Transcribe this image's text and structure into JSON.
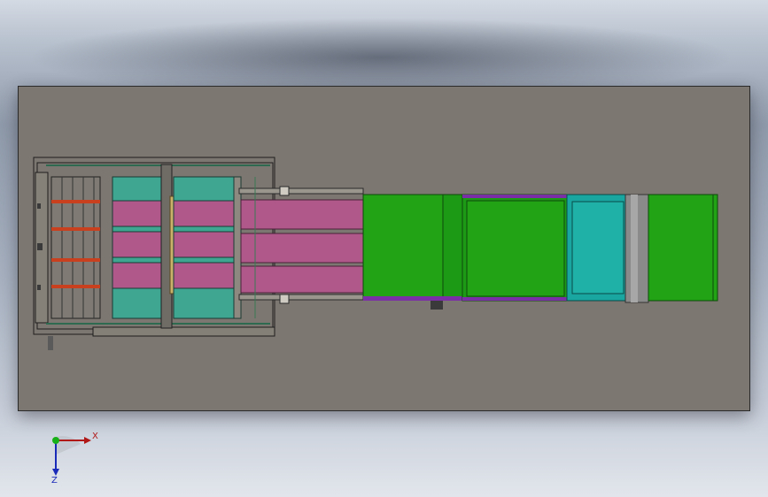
{
  "triad": {
    "x_label": "X",
    "z_label": "Z"
  },
  "colors": {
    "background_top": "#d4dae3",
    "plate": "#7c7770",
    "teal_panel": "#3fa692",
    "pink_panel": "#b0588a",
    "green_conveyor": "#22a316",
    "green_conveyor_dark": "#1d9a15",
    "cyan_section": "#1aa6a0",
    "purple_trim": "#7a2fa6",
    "roller_gray": "#8a8a8a",
    "red_bar": "#c8401e"
  }
}
